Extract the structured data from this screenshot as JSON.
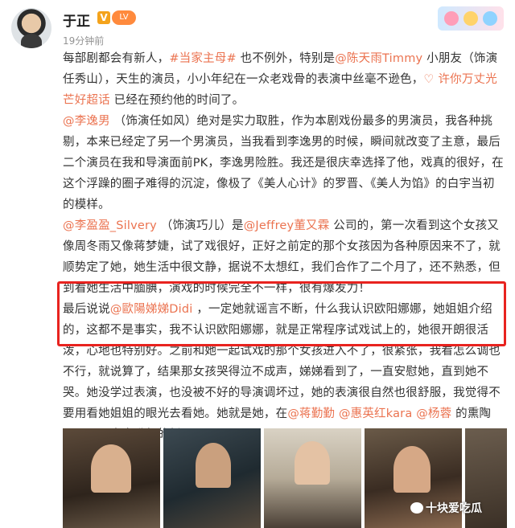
{
  "header": {
    "username": "于正",
    "v_badge": "V",
    "level_badge": "LV",
    "timestamp": "19分钟前"
  },
  "post": {
    "p1": [
      {
        "t": "每部剧都会有新人，"
      },
      {
        "t": "#当家主母#",
        "link": true
      },
      {
        "t": " 也不例外，特别是"
      },
      {
        "t": "@陈天雨Timmy",
        "link": true
      },
      {
        "t": " 小朋友（饰演任秀山），天生的演员，小小年纪在一众老戏骨的表演中丝毫不逊色，"
      },
      {
        "t": "♡ 许你万丈光芒好超话",
        "link": true
      },
      {
        "t": " 已经在预约他的时间了。"
      }
    ],
    "p2": [
      {
        "t": "@李逸男",
        "link": true
      },
      {
        "t": " （饰演任如风）绝对是实力取胜，作为本剧戏份最多的男演员，我各种挑剔，本来已经定了另一个男演员，当我看到李逸男的时候，瞬间就改变了主意，最后二个演员在我和导演面前PK，李逸男险胜。我还是很庆幸选择了他，戏真的很好，在这个浮躁的圈子难得的沉淀，像极了《美人心计》的罗晋、《美人为馅》的白宇当初的模样。"
      }
    ],
    "p3": [
      {
        "t": "@李盈盈_Silvery",
        "link": true
      },
      {
        "t": " （饰演巧儿）是"
      },
      {
        "t": "@Jeffrey董又霖",
        "link": true
      },
      {
        "t": " 公司的，第一次看到这个女孩又像周冬雨又像蒋梦婕，试了戏很好，正好之前定的那个女孩因为各种原因来不了，就顺势定了她，她生活中很文静，据说不太想红，我们合作了二个月了，还不熟悉，但到看她生活中腼腆，演戏的时候完全不一样，很有爆发力！"
      }
    ],
    "p4": [
      {
        "t": "最后说说"
      },
      {
        "t": "@歐陽娣娣Didi",
        "link": true
      },
      {
        "t": " ，一定她就谣言不断，什么我认识欧阳娜娜，她姐姐介绍的，这都不是事实，我不认识欧阳娜娜，就是正常程序试戏试上的，她很开朗很活泼，心地也特别好。之前和她一起试戏的那个女孩进入不了，很紧张，我看怎么调也不行，就说算了，结果那女孩哭得泣不成声，娣娣看到了，一直安慰她，直到她不哭。她没学过表演，也没被不好的导演调坏过，她的表演很自然也很舒服，我觉得不要用看她姐姐的眼光去看她。她就是她，在"
      },
      {
        "t": "@蒋勤勤",
        "link": true
      },
      {
        "t": " "
      },
      {
        "t": "@惠英红kara",
        "link": true
      },
      {
        "t": " "
      },
      {
        "t": "@杨蓉",
        "link": true
      },
      {
        "t": " 的熏陶下，一颗冉冉升起的新星！"
      }
    ]
  },
  "watermark": {
    "text": "十块爱吃瓜"
  }
}
